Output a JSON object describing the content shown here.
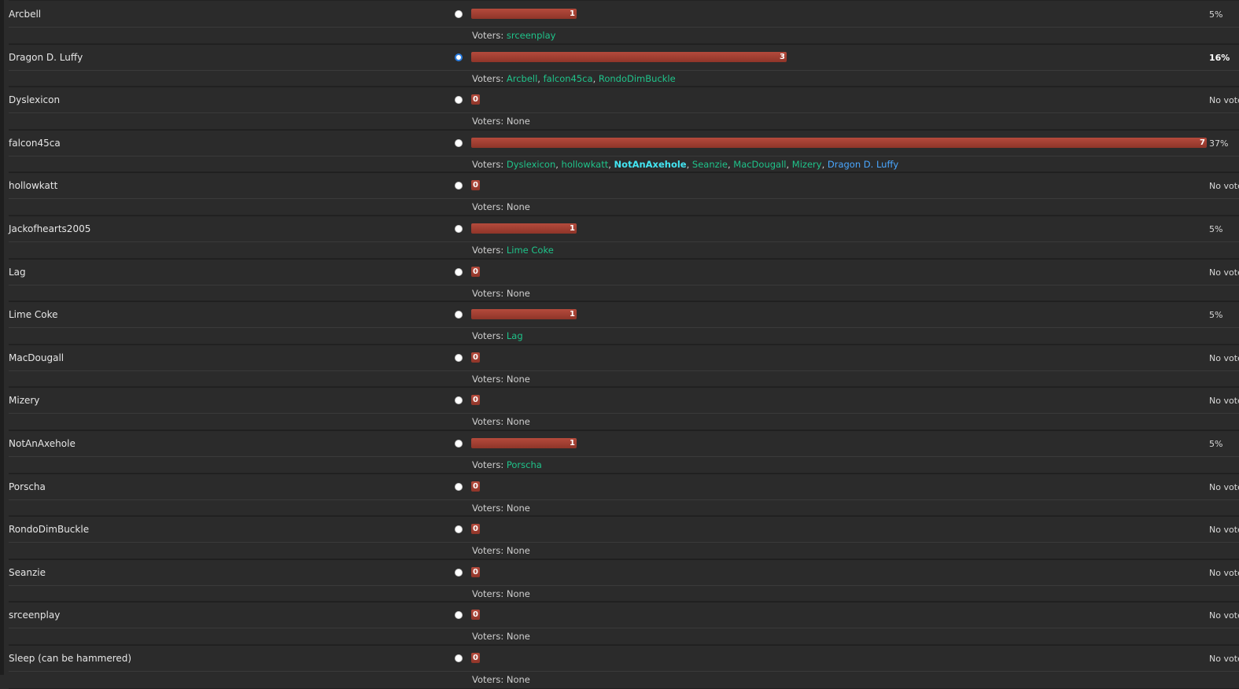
{
  "colors": {
    "background": "#2b2b2b",
    "bar": "#a33f32",
    "voter_green": "#1fc38a",
    "voter_cyan": "#43e5f2",
    "voter_blue": "#4aa7ff",
    "radio_selected": "#2a7de1"
  },
  "voters_label": "Voters:",
  "options": [
    {
      "name": "Arcbell",
      "count": "1",
      "bar_fraction": 0.1429,
      "percent": "5%",
      "selected": false,
      "voters": [
        {
          "name": "srceenplay",
          "style": "green"
        }
      ]
    },
    {
      "name": "Dragon D. Luffy",
      "count": "3",
      "bar_fraction": 0.4286,
      "percent": "16%",
      "percent_bold": true,
      "selected": true,
      "voters": [
        {
          "name": "Arcbell",
          "style": "green"
        },
        {
          "name": "falcon45ca",
          "style": "green"
        },
        {
          "name": "RondoDimBuckle",
          "style": "green"
        }
      ]
    },
    {
      "name": "Dyslexicon",
      "count": "0",
      "bar_fraction": 0,
      "percent": "No vote",
      "selected": false,
      "voters_text": "None",
      "voters": []
    },
    {
      "name": "falcon45ca",
      "count": "7",
      "bar_fraction": 1.0,
      "percent": "37%",
      "selected": false,
      "voters": [
        {
          "name": "Dyslexicon",
          "style": "green"
        },
        {
          "name": "hollowkatt",
          "style": "green"
        },
        {
          "name": "NotAnAxehole",
          "style": "cyan"
        },
        {
          "name": "Seanzie",
          "style": "green"
        },
        {
          "name": "MacDougall",
          "style": "green"
        },
        {
          "name": "Mizery",
          "style": "green"
        },
        {
          "name": "Dragon D. Luffy",
          "style": "blue"
        }
      ]
    },
    {
      "name": "hollowkatt",
      "count": "0",
      "bar_fraction": 0,
      "percent": "No vote",
      "selected": false,
      "voters_text": "None",
      "voters": []
    },
    {
      "name": "Jackofhearts2005",
      "count": "1",
      "bar_fraction": 0.1429,
      "percent": "5%",
      "selected": false,
      "voters": [
        {
          "name": "Lime Coke",
          "style": "green"
        }
      ]
    },
    {
      "name": "Lag",
      "count": "0",
      "bar_fraction": 0,
      "percent": "No vote",
      "selected": false,
      "voters_text": "None",
      "voters": []
    },
    {
      "name": "Lime Coke",
      "count": "1",
      "bar_fraction": 0.1429,
      "percent": "5%",
      "selected": false,
      "voters": [
        {
          "name": "Lag",
          "style": "green"
        }
      ]
    },
    {
      "name": "MacDougall",
      "count": "0",
      "bar_fraction": 0,
      "percent": "No vote",
      "selected": false,
      "voters_text": "None",
      "voters": []
    },
    {
      "name": "Mizery",
      "count": "0",
      "bar_fraction": 0,
      "percent": "No vote",
      "selected": false,
      "voters_text": "None",
      "voters": []
    },
    {
      "name": "NotAnAxehole",
      "count": "1",
      "bar_fraction": 0.1429,
      "percent": "5%",
      "selected": false,
      "voters": [
        {
          "name": "Porscha",
          "style": "green"
        }
      ]
    },
    {
      "name": "Porscha",
      "count": "0",
      "bar_fraction": 0,
      "percent": "No vote",
      "selected": false,
      "voters_text": "None",
      "voters": []
    },
    {
      "name": "RondoDimBuckle",
      "count": "0",
      "bar_fraction": 0,
      "percent": "No vote",
      "selected": false,
      "voters_text": "None",
      "voters": []
    },
    {
      "name": "Seanzie",
      "count": "0",
      "bar_fraction": 0,
      "percent": "No vote",
      "selected": false,
      "voters_text": "None",
      "voters": []
    },
    {
      "name": "srceenplay",
      "count": "0",
      "bar_fraction": 0,
      "percent": "No vote",
      "selected": false,
      "voters_text": "None",
      "voters": []
    },
    {
      "name": "Sleep (can be hammered)",
      "count": "0",
      "bar_fraction": 0,
      "percent": "No vote",
      "selected": false,
      "voters_text": "None",
      "voters": []
    }
  ]
}
